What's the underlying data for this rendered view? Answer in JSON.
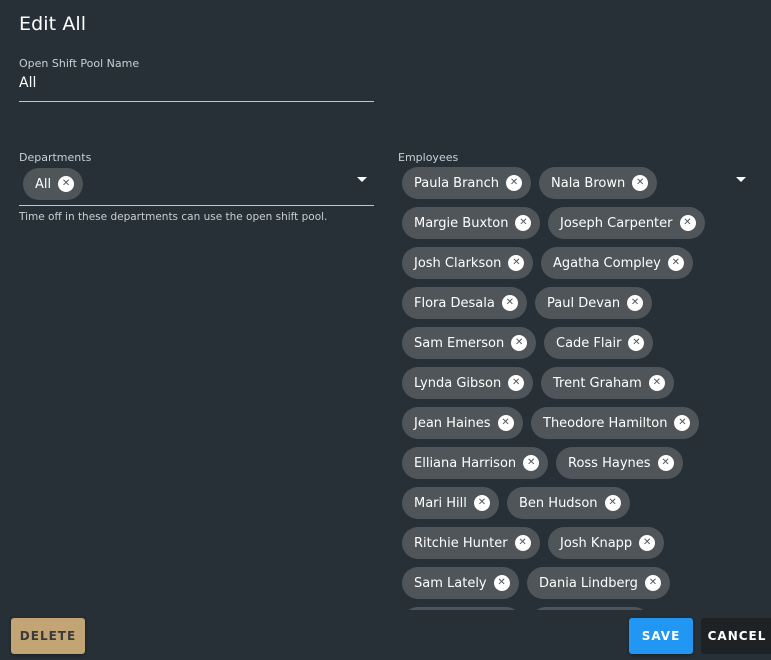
{
  "dialog": {
    "title": "Edit All"
  },
  "pool_name": {
    "label": "Open Shift Pool Name",
    "value": "All"
  },
  "departments": {
    "label": "Departments",
    "chips": [
      "All"
    ],
    "helper": "Time off in these departments can use the open shift pool."
  },
  "employees": {
    "label": "Employees",
    "chips": [
      "Paula Branch",
      "Nala Brown",
      "Margie Buxton",
      "Joseph Carpenter",
      "Josh Clarkson",
      "Agatha Compley",
      "Flora Desala",
      "Paul Devan",
      "Sam Emerson",
      "Cade Flair",
      "Lynda Gibson",
      "Trent Graham",
      "Jean Haines",
      "Theodore Hamilton",
      "Elliana Harrison",
      "Ross Haynes",
      "Mari Hill",
      "Ben Hudson",
      "Ritchie Hunter",
      "Josh Knapp",
      "Sam Lately",
      "Dania Lindberg"
    ]
  },
  "buttons": {
    "delete": "DELETE",
    "save": "SAVE",
    "cancel": "CANCEL"
  },
  "icons": {
    "chip_remove": "close-circle-icon",
    "dropdown": "arrow-drop-down-icon"
  },
  "colors": {
    "background": "#263036",
    "chip": "#4f5558",
    "save": "#2196f3",
    "delete": "#c3a474"
  }
}
